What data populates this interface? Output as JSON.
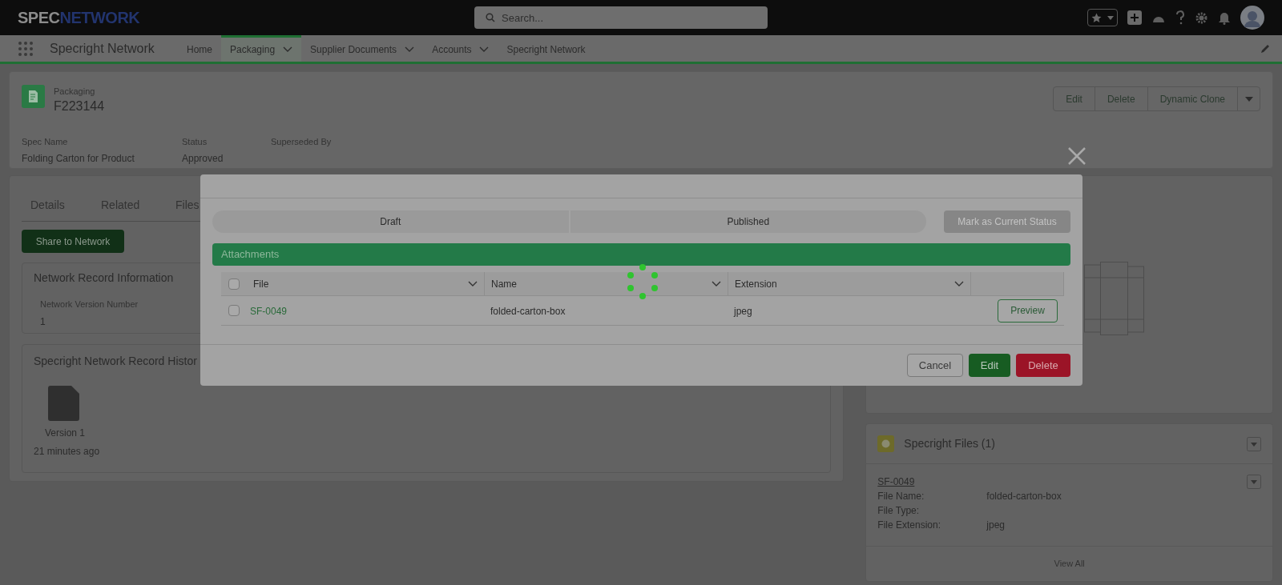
{
  "top_bar": {
    "logo": [
      "SPEC",
      "NETWORK"
    ],
    "search": {
      "placeholder": "Search..."
    }
  },
  "nav": {
    "app_name": "Specright Network",
    "items": [
      {
        "label": "Home",
        "selected": false,
        "has_menu": false
      },
      {
        "label": "Packaging",
        "selected": true,
        "has_menu": true
      },
      {
        "label": "Supplier Documents",
        "selected": false,
        "has_menu": true
      },
      {
        "label": "Accounts",
        "selected": false,
        "has_menu": true
      },
      {
        "label": "Specright Network",
        "selected": false,
        "has_menu": false
      }
    ]
  },
  "record": {
    "object_type": "Packaging",
    "name": "F223144",
    "actions": [
      "Edit",
      "Delete",
      "Dynamic Clone"
    ],
    "fields": [
      {
        "label": "Spec Name",
        "value": "Folding Carton for Product"
      },
      {
        "label": "Status",
        "value": "Approved"
      },
      {
        "label": "Superseded By"
      }
    ]
  },
  "tabs": [
    "Details",
    "Related",
    "Files"
  ],
  "share_button": "Share to Network",
  "network_info": {
    "title": "Network Record Information",
    "field_label": "Network Version Number",
    "field_value": "1"
  },
  "history": {
    "title": "Specright Network Record Histor",
    "version": "Version 1",
    "time": "21 minutes ago"
  },
  "files_panel": {
    "title": "Specright Files (1)",
    "link": "SF-0049",
    "details": [
      {
        "label": "File Name:",
        "value": "folded-carton-box"
      },
      {
        "label": "File Type:"
      },
      {
        "label": "File Extension:",
        "value": "jpeg"
      }
    ],
    "view_all": "View All"
  },
  "modal": {
    "path": [
      "Draft",
      "Published"
    ],
    "mark_button": {
      "label": "Mark as Current Status",
      "disabled": true
    },
    "section": "Attachments",
    "columns": [
      "File",
      "Name",
      "Extension"
    ],
    "header_checked": false,
    "rows": [
      {
        "file": "SF-0049",
        "name": "folded-carton-box",
        "extension": "jpeg",
        "action": "Preview",
        "checked": false
      }
    ],
    "loading": true,
    "buttons": [
      {
        "label": "Cancel",
        "kind": "neutral"
      },
      {
        "label": "Edit",
        "kind": "brand"
      },
      {
        "label": "Delete",
        "kind": "destructive"
      }
    ]
  }
}
